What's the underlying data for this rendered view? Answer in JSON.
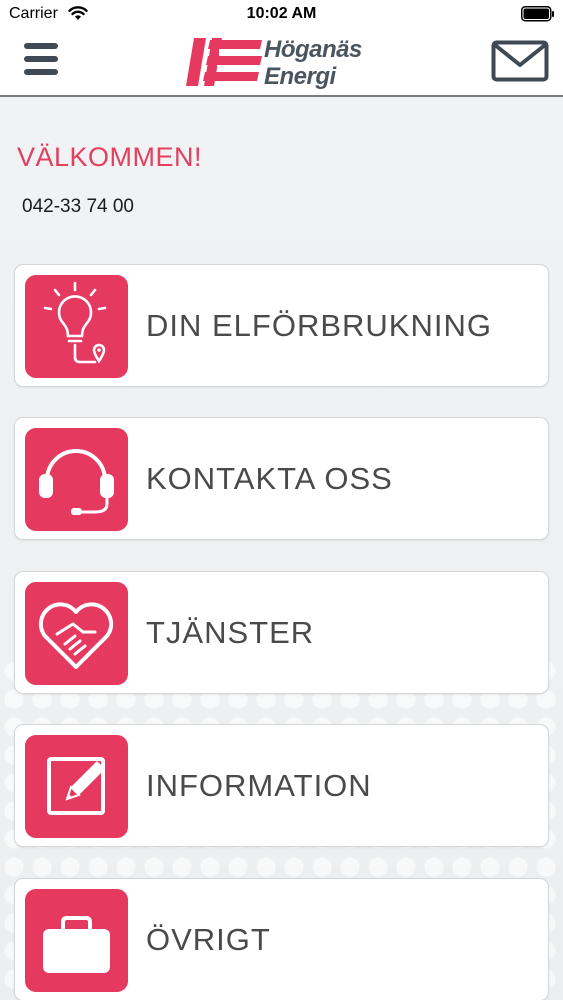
{
  "status_bar": {
    "carrier": "Carrier",
    "time": "10:02 AM"
  },
  "header": {
    "logo_line1": "Höganäs",
    "logo_line2": "Energi",
    "brand_color": "#e5395f",
    "menu_icon": "hamburger-menu-icon",
    "mail_icon": "envelope-icon"
  },
  "main": {
    "welcome": "VÄLKOMMEN!",
    "phone": "042-33 74 00",
    "items": [
      {
        "label": "DIN ELFÖRBRUKNING",
        "icon": "lightbulb-icon"
      },
      {
        "label": "KONTAKTA OSS",
        "icon": "headset-icon"
      },
      {
        "label": "TJÄNSTER",
        "icon": "heart-handshake-icon"
      },
      {
        "label": "INFORMATION",
        "icon": "edit-note-icon"
      },
      {
        "label": "ÖVRIGT",
        "icon": "briefcase-icon"
      }
    ]
  }
}
